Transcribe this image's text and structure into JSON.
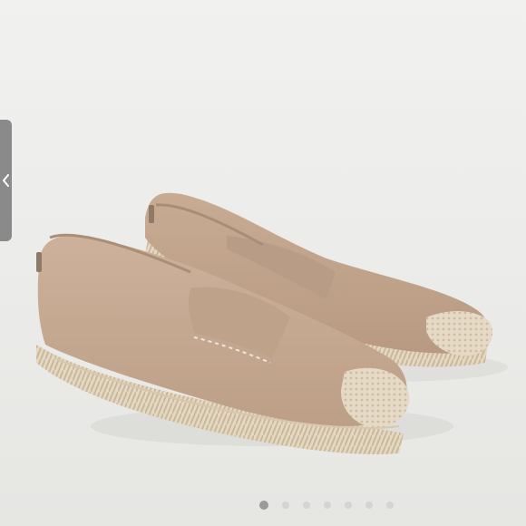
{
  "gallery": {
    "image_subject": "product-photo",
    "image_count": 7,
    "active_index": 0,
    "dots": [
      {
        "active": true
      },
      {
        "active": false
      },
      {
        "active": false
      },
      {
        "active": false
      },
      {
        "active": false
      },
      {
        "active": false
      },
      {
        "active": false
      }
    ],
    "prev_icon": "chevron-left-icon"
  },
  "colors": {
    "background": "#ebebe9",
    "suede": "#c6a890",
    "jute": "#e3d6c0",
    "tab": "#8a8a8a",
    "dot_active": "#9a9a9a",
    "dot_inactive": "#d4d4d2"
  }
}
